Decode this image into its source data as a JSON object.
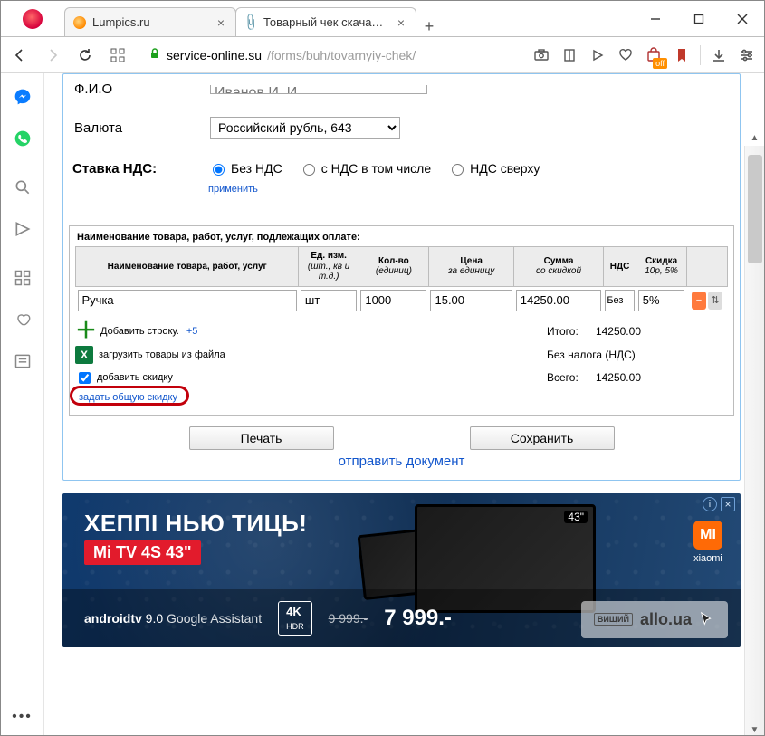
{
  "window": {
    "tabs": [
      {
        "title": "Lumpics.ru"
      },
      {
        "title": "Товарный чек скачать, ра"
      }
    ]
  },
  "addressbar": {
    "domain": "service-online.su",
    "path": "/forms/buh/tovarnyiy-chek/"
  },
  "form": {
    "fio_label": "Ф.И.О",
    "fio_value": "Иванов И. И.",
    "currency_label": "Валюта",
    "currency_value": "Российский рубль, 643",
    "nds_label": "Ставка НДС:",
    "nds_options": {
      "none": "Без НДС",
      "incl": "с НДС в том числе",
      "top": "НДС сверху"
    },
    "nds_selected": "none",
    "nds_apply": "применить"
  },
  "goods": {
    "section_title": "Наименование товара, работ, услуг, подлежащих оплате:",
    "headers": {
      "name": "Наименование товара, работ, услуг",
      "unit": "Ед. изм.",
      "unit_sub": "(шт., кв и т.д.)",
      "qty": "Кол-во",
      "qty_sub": "(единиц)",
      "price": "Цена",
      "price_sub": "за единицу",
      "sum": "Сумма",
      "sum_sub": "со скидкой",
      "nds": "НДС",
      "disc": "Скидка",
      "disc_sub": "10р, 5%"
    },
    "rows": [
      {
        "name": "Ручка",
        "unit": "шт",
        "qty": "1000",
        "price": "15.00",
        "sum": "14250.00",
        "nds": "Без",
        "disc": "5%"
      }
    ],
    "links": {
      "add_row": "Добавить строку.",
      "plus5": "+5",
      "load_file": "загрузить товары из файла",
      "add_discount": "добавить скидку",
      "set_total_discount": "задать общую скидку"
    },
    "totals": {
      "itogo_label": "Итого:",
      "itogo_value": "14250.00",
      "tax_label": "Без налога (НДС)",
      "vsego_label": "Всего:",
      "vsego_value": "14250.00"
    }
  },
  "actions": {
    "print": "Печать",
    "save": "Сохранить",
    "send": "отправить документ"
  },
  "ad": {
    "headline": "ХЕППІ НЬЮ ТИЦЬ!",
    "product": "Mi TV 4S 43\"",
    "androidtv1": "androidtv",
    "androidtv2": "9.0",
    "ga": "Google Assistant",
    "fourk": "4K",
    "hdr": "HDR",
    "old_price": "9 999.-",
    "new_price": "7 999.-",
    "brand": "xiaomi",
    "tv_size": "43\"",
    "allo": "allo.ua",
    "allo_badge": "ВИЩИЙ"
  }
}
